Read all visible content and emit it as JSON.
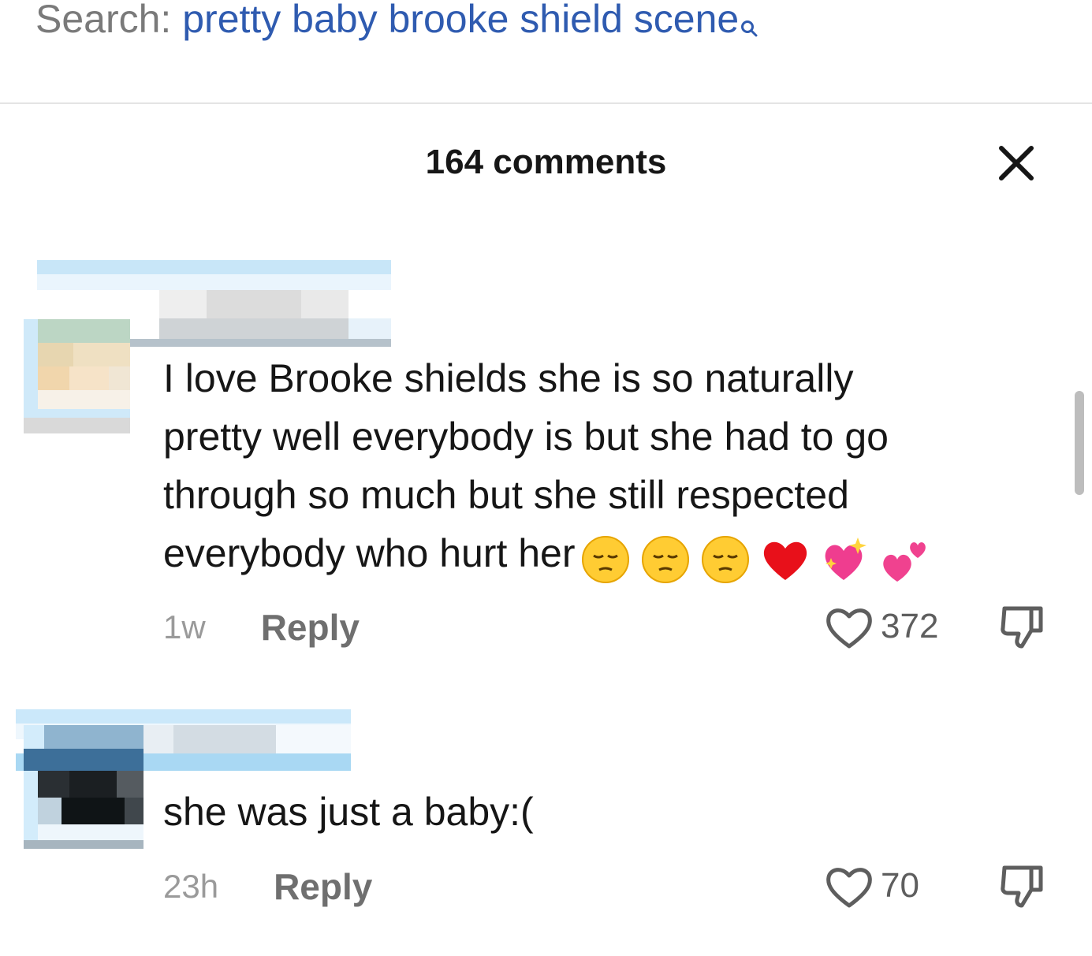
{
  "search": {
    "prefix": "Search:",
    "query": "pretty baby brooke shield scene",
    "icon": "search-icon"
  },
  "header": {
    "title": "164 comments",
    "close_icon": "close-icon"
  },
  "colors": {
    "link": "#2f5bb0",
    "text": "#161616",
    "muted": "#9a9a9a"
  },
  "comments": [
    {
      "lines": [
        "I love Brooke shields she is so naturally",
        "pretty well everybody is but she had to go",
        "through so much but she still respected",
        "everybody who hurt her"
      ],
      "emojis": [
        "pensive-face-emoji",
        "pensive-face-emoji",
        "pensive-face-emoji",
        "red-heart-emoji",
        "sparkling-heart-emoji",
        "two-hearts-emoji"
      ],
      "time": "1w",
      "reply_label": "Reply",
      "likes": "372"
    },
    {
      "lines": [
        "she was just a baby:("
      ],
      "emojis": [],
      "time": "23h",
      "reply_label": "Reply",
      "likes": "70"
    }
  ]
}
